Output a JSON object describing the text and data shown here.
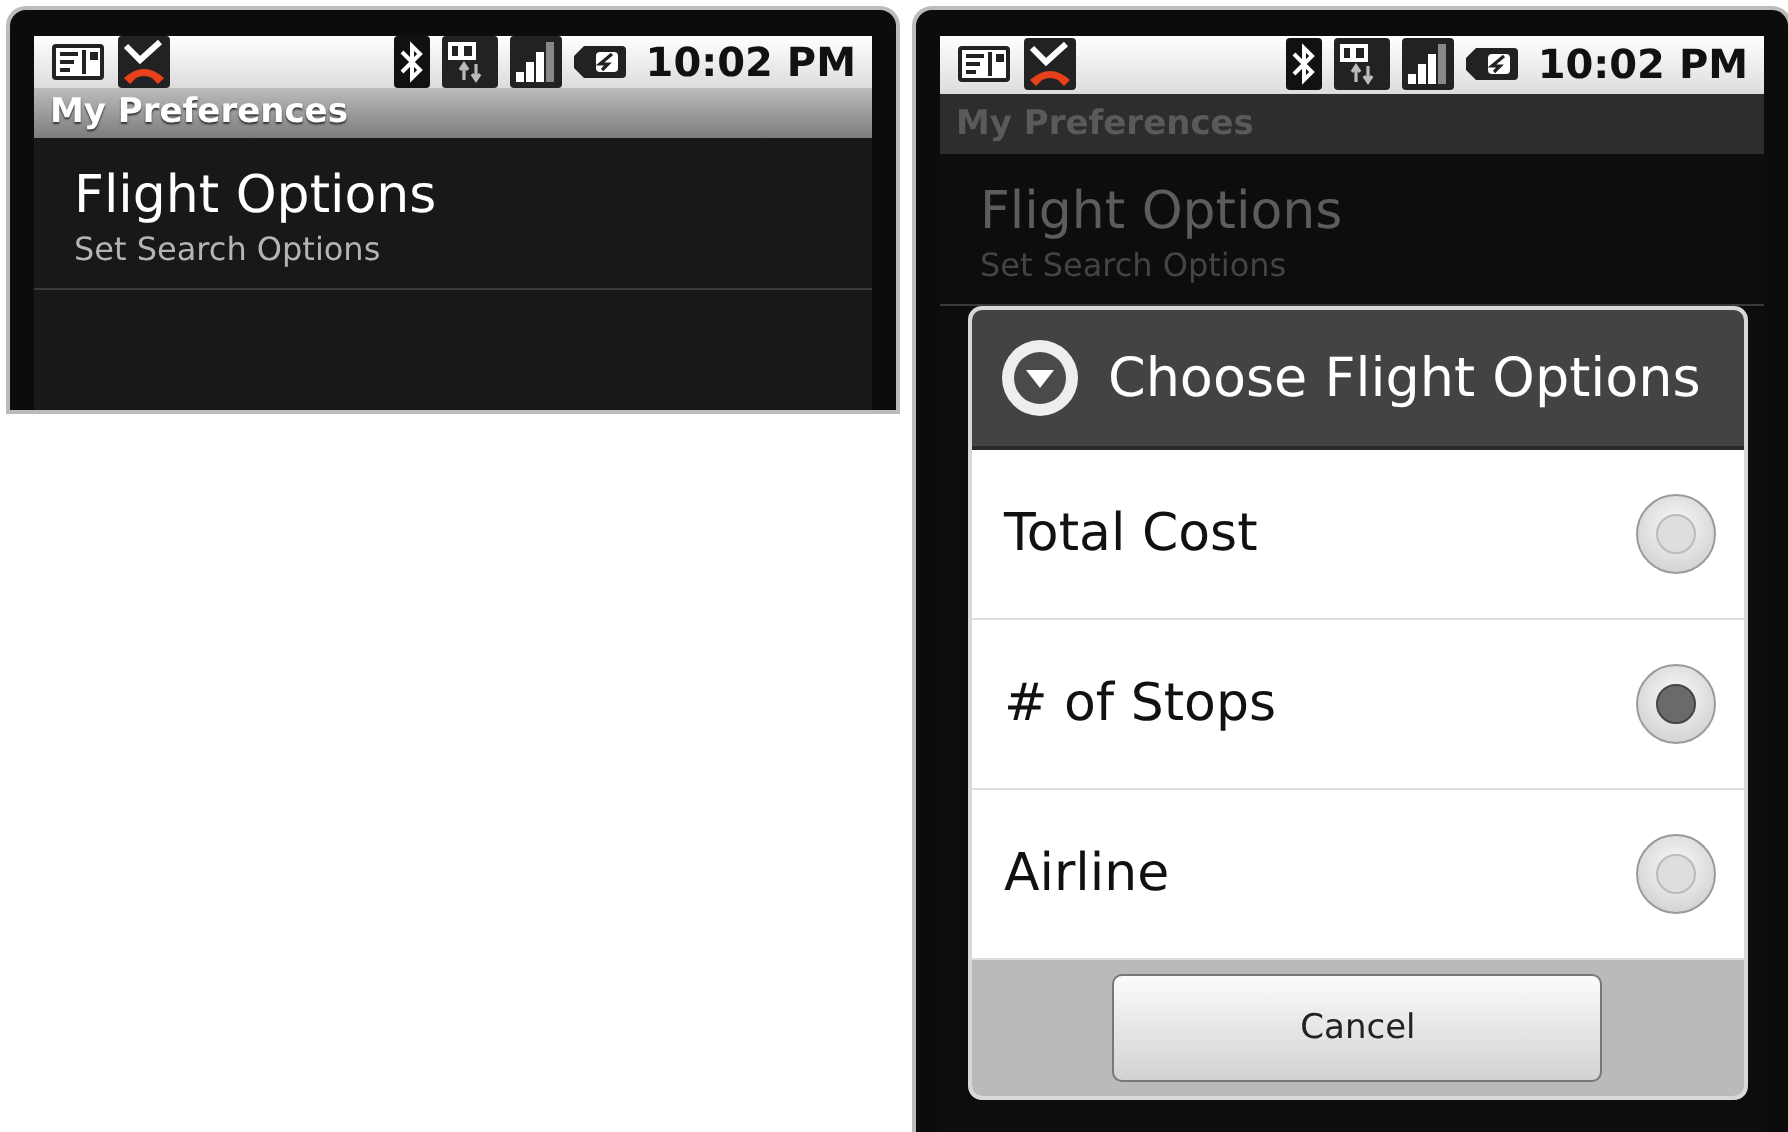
{
  "screens": [
    {
      "dimmed": false,
      "status_bar": {
        "time": "10:02 PM"
      },
      "title_bar": {
        "title": "My Preferences"
      },
      "preferences": [
        {
          "title": "Flight Options",
          "summary": "Set Search Options"
        }
      ]
    },
    {
      "dimmed": true,
      "status_bar": {
        "time": "10:02 PM"
      },
      "title_bar": {
        "title": "My Preferences"
      },
      "preferences": [
        {
          "title": "Flight Options",
          "summary": "Set Search Options"
        }
      ],
      "dialog": {
        "title": "Choose Flight Options",
        "options": [
          {
            "label": "Total Cost",
            "selected": false
          },
          {
            "label": "# of Stops",
            "selected": true
          },
          {
            "label": "Airline",
            "selected": false
          }
        ],
        "buttons": [
          "Cancel"
        ]
      }
    }
  ]
}
